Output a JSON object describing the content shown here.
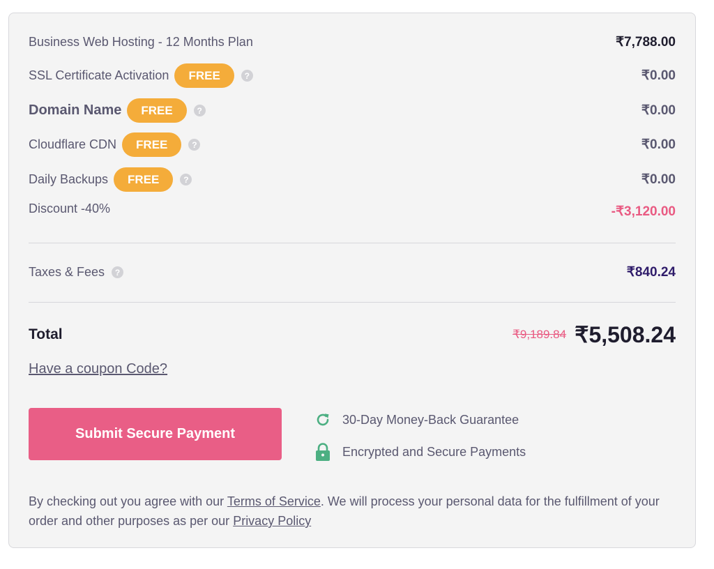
{
  "line_items": [
    {
      "label": "Business Web Hosting - 12 Months Plan",
      "amount": "₹7,788.00"
    },
    {
      "label": "SSL Certificate Activation",
      "badge": "FREE",
      "amount": "₹0.00"
    },
    {
      "label": "Domain Name",
      "badge": "FREE",
      "amount": "₹0.00"
    },
    {
      "label": "Cloudflare CDN",
      "badge": "FREE",
      "amount": "₹0.00"
    },
    {
      "label": "Daily Backups",
      "badge": "FREE",
      "amount": "₹0.00"
    },
    {
      "label": "Discount -40%",
      "amount": "-₹3,120.00"
    }
  ],
  "taxes": {
    "label": "Taxes & Fees",
    "amount": "₹840.24"
  },
  "total": {
    "label": "Total",
    "old_price": "₹9,189.84",
    "price": "₹5,508.24"
  },
  "coupon_link": "Have a coupon Code?",
  "submit_button": "Submit Secure Payment",
  "features": [
    {
      "icon": "refresh-icon",
      "text": "30-Day Money-Back Guarantee"
    },
    {
      "icon": "lock-icon",
      "text": "Encrypted and Secure Payments"
    }
  ],
  "legal": {
    "part1": "By checking out you agree with our ",
    "terms_link": "Terms of Service",
    "part2": ". We will process your personal data for the fulfillment of your order and other purposes as per our ",
    "privacy_link": "Privacy Policy"
  },
  "colors": {
    "accent_pink": "#e95e86",
    "badge_orange": "#f4ac3a",
    "feature_green": "#4caf82",
    "tax_navy": "#2f1c6a"
  }
}
